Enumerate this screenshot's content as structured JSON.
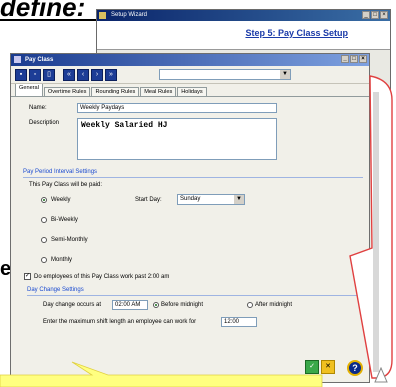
{
  "heading": {
    "text": "define:"
  },
  "background_letter": "e",
  "wizard": {
    "title": "Setup Wizard",
    "step_title": "Step 5: Pay Class Setup",
    "help": "?"
  },
  "window": {
    "title": "Pay Class",
    "controls": [
      "_",
      "□",
      "×"
    ],
    "toolbar": [
      "save",
      "new",
      "delete",
      "first",
      "previous",
      "next",
      "last"
    ],
    "record_selector": "",
    "tabs": [
      "General",
      "Overtime Rules",
      "Rounding Rules",
      "Meal Rules",
      "Holidays"
    ],
    "active_tab": "General"
  },
  "form": {
    "name_label": "Name:",
    "name_value": "Weekly Paydays",
    "description_label": "Description",
    "description_value": "Weekly Salaried HJ",
    "pay_period_title": "Pay Period Interval Settings",
    "paid_label": "This Pay Class will be paid:",
    "intervals": [
      {
        "label": "Weekly",
        "selected": true
      },
      {
        "label": "Bi-Weekly",
        "selected": false
      },
      {
        "label": "Semi-Monthly",
        "selected": false
      },
      {
        "label": "Monthly",
        "selected": false
      }
    ],
    "start_day_label": "Start Day:",
    "start_day_value": "Sunday",
    "work_past_label": "Do employees of this Pay Class work past 2:00 am",
    "work_past_checked": true,
    "day_change_title": "Day Change Settings",
    "day_change_label": "Day change occurs at",
    "day_change_time": "02:00 AM",
    "before_midnight_label": "Before midnight",
    "after_midnight_label": "After midnight",
    "before_selected": true,
    "max_shift_label": "Enter the maximum shift length an employee can work for",
    "max_shift_value": "12:00"
  },
  "colors": {
    "accent": "#1a3aa8",
    "callout_border": "#e04040",
    "callout_fill": "#ffff80"
  }
}
